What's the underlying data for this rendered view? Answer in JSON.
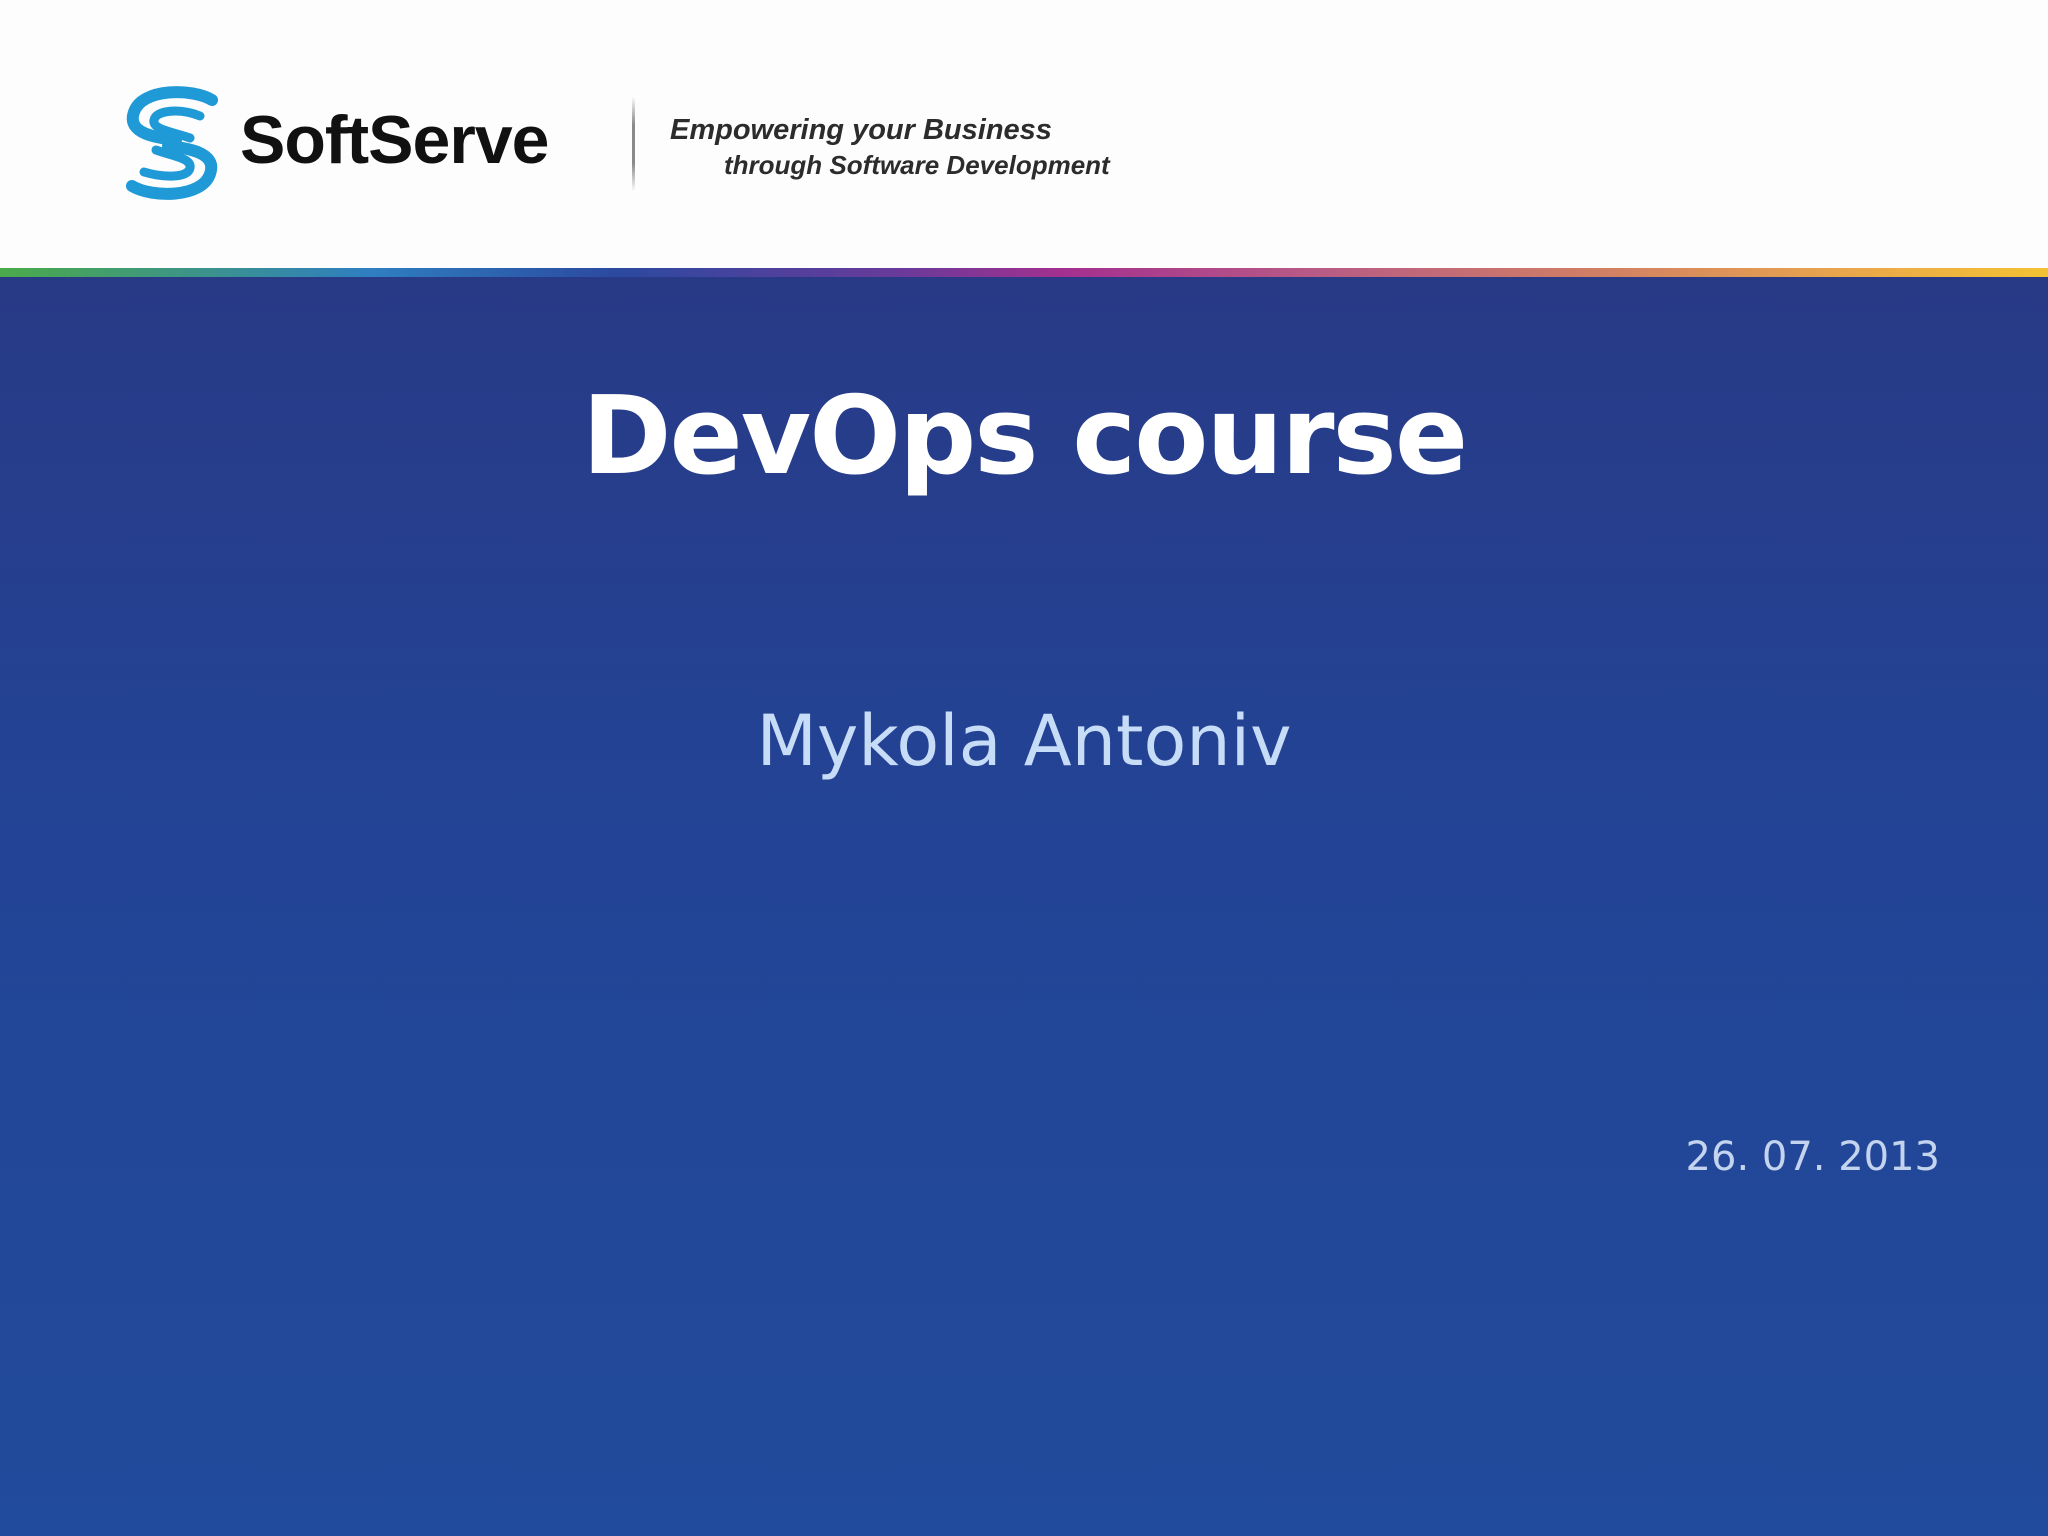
{
  "header": {
    "logo_icon": "softserve-s-logo-icon",
    "brand_name": "SoftServe",
    "tagline_line1": "Empowering your Business",
    "tagline_line2": "through Software Development"
  },
  "slide": {
    "title": "DevOps course",
    "author": "Mykola Antoniv",
    "date": "26. 07. 2013"
  },
  "colors": {
    "slide_background": "#234496",
    "title_text": "#ffffff",
    "author_text": "#c7dcf6",
    "date_text": "#c4d4ee",
    "logo_blue": "#1f9ad7",
    "stripe_start": "#4bab4a",
    "stripe_mid": "#a4308f",
    "stripe_end": "#f3c233"
  }
}
